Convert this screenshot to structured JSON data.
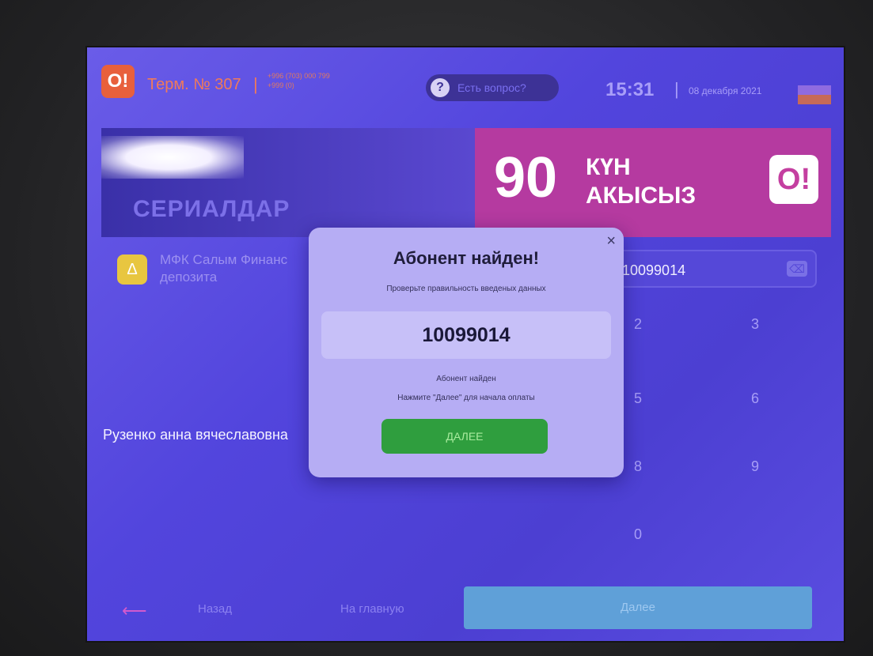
{
  "header": {
    "logo": "O!",
    "terminal": "Терм. № 307",
    "separator": "|",
    "phones": [
      "+996 (703) 000 799",
      "+999 (0)"
    ],
    "help_icon": "?",
    "help_label": "Есть вопрос?",
    "time": "15:31",
    "date": "08 декабря 2021"
  },
  "banner": {
    "left_text": "СЕРИАЛДАР",
    "right_number": "90",
    "right_line1": "КҮН",
    "right_line2": "АКЫСЫЗ",
    "right_logo": "O!"
  },
  "provider": {
    "icon": "Δ",
    "name": "МФК Салым Финанс депозита"
  },
  "account_field": {
    "value": "10099014"
  },
  "subscriber_name": "Рузенко анна вячеславовна",
  "keypad": [
    "2",
    "3",
    "5",
    "6",
    "8",
    "9",
    "0"
  ],
  "bottom": {
    "back_arrow": "⟵",
    "back": "Назад",
    "home": "На главную",
    "next": "Далее"
  },
  "modal": {
    "close": "×",
    "title": "Абонент найден!",
    "subtitle": "Проверьте правильность введеных данных",
    "account": "10099014",
    "found": "Абонент найден",
    "hint": "Нажмите \"Далее\" для начала оплаты",
    "button": "ДАЛЕЕ"
  },
  "colors": {
    "screen": "#4c3fd6",
    "modal": "#b6adf4",
    "primary_button": "#2f9e3e",
    "next_bar": "#5fa0d8"
  }
}
